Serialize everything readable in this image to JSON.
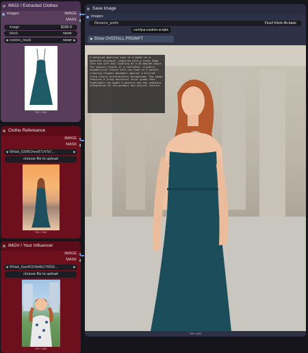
{
  "nodes": {
    "extracted": {
      "title": "IMG2 / Extracted Clothes",
      "inputs": {
        "images": "images"
      },
      "outputs": {
        "image": "IMAGE",
        "mask": "MASK"
      },
      "widgets": {
        "image": {
          "label": "image",
          "value": "$105-0"
        },
        "block": {
          "label": "block",
          "value": "never"
        },
        "restore_mask": {
          "label": "restore_mask",
          "value": "never"
        }
      },
      "caption": "768 × 1365"
    },
    "reference": {
      "title": "Clothe Refereance",
      "outputs": {
        "image": "IMAGE",
        "mask": "MASK"
      },
      "file": "Whisk_630f514ee87147b7...",
      "upload_label": "choose file to upload",
      "caption": "768 × 1365"
    },
    "influencer": {
      "title": "IMGV / Your Influencer",
      "outputs": {
        "image": "IMAGE",
        "mask": "MASK"
      },
      "file": "Whisk_6ae40318d4b176659...",
      "upload_label": "choose file to upload",
      "caption": "768 × 1365"
    },
    "save": {
      "title": "Save Image",
      "inputs": {
        "images": "images"
      },
      "filename_label": "filename_prefix",
      "filename_value": "Flux2-Klein-4b-base",
      "tooltip": "comfyui-custom-scripts",
      "show_prompt": "Show OVERALL PROMPT",
      "prompt_text": "A balanced American shot of a model at a moderate distance, captured with a clean 35mm lens and soft-box lighting at a 45-degree angle. The subject stands in a confident, slightly asymmetrical stance with one hand in a pocket, creating elegant movement against a blurred ultra-luxury architectural background. The image features a crisp editorial color grade that highlights the model's posture and the seamless integration of the garment and natural texture.",
      "caption": "768 × 1152"
    }
  },
  "colors": {
    "canvas": "#15151b",
    "node_purple": "#5a3d5c",
    "node_red": "#6e0f1e",
    "node_blue": "#2e3046",
    "wire": "#6b8fd8"
  }
}
